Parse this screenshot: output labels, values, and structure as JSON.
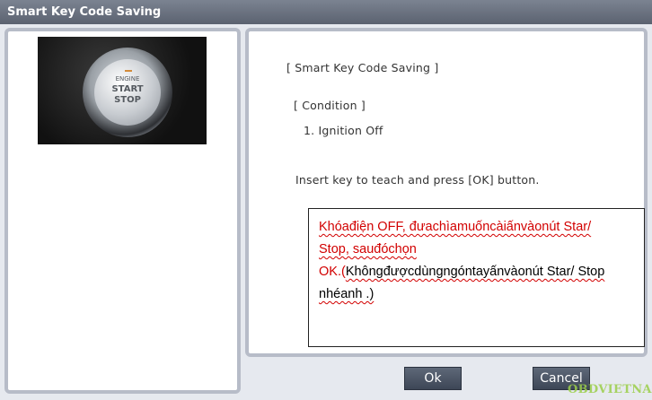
{
  "window": {
    "title": "Smart Key Code Saving"
  },
  "photo": {
    "button_engine": "ENGINE",
    "button_start": "START",
    "button_stop": "STOP"
  },
  "panel": {
    "title": "[ Smart Key Code Saving ]",
    "condition_heading": "[ Condition ]",
    "condition_item": "1. Ignition Off",
    "instruction": "Insert key to teach and press [OK] button."
  },
  "note": {
    "line1_red": "Khóađiện OFF, đưachìamuốncàiấnvàonút Star/",
    "line2_red": "Stop, sauđóchọn",
    "line3_red": "OK.(",
    "line3_black": "Khôngđượcdùngngóntayấnvàonút Star/ Stop",
    "line4_black": "nhéanh .)"
  },
  "buttons": {
    "ok": "Ok",
    "cancel": "Cancel"
  },
  "watermark": "OBDVIETNAM"
}
